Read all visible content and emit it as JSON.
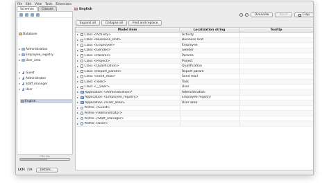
{
  "menu": [
    "File",
    "Edit",
    "View",
    "Tools",
    "Extensions"
  ],
  "tabs": [
    "Schemas",
    "Classes"
  ],
  "tree": {
    "items": [
      {
        "label": "Database",
        "icon": "database-icon"
      },
      {
        "label": "Administration",
        "icon": "folder-icon"
      },
      {
        "label": "Employee_registry",
        "icon": "folder-icon"
      },
      {
        "label": "User_area",
        "icon": "folder-icon"
      },
      {
        "label": "Guest",
        "icon": "user-icon"
      },
      {
        "label": "Administrator",
        "icon": "user-icon"
      },
      {
        "label": "Staff_manager",
        "icon": "user-icon"
      },
      {
        "label": "User",
        "icon": "user-icon"
      },
      {
        "label": "English",
        "icon": "flag-icon"
      }
    ]
  },
  "status": {
    "cpu_label": "CPU: 0%",
    "progress_label": "",
    "progress_fraction": 0.55,
    "lcf_label": "LCF:",
    "lcf_value": "739",
    "details_button": "Details..."
  },
  "editor": {
    "title": "English",
    "overview_button": "Overview",
    "reset_button": "Reset",
    "crop_button": "Crop",
    "expand_all": "Expand all",
    "collapse_all": "Collapse all",
    "find_replace": "Find and replace"
  },
  "table": {
    "columns": [
      "Model item",
      "Localization string",
      "Tooltip"
    ],
    "rows": [
      {
        "item": "Class <Activity>",
        "loc": "Activity",
        "type": "class"
      },
      {
        "item": "Class <Business_Unit>",
        "loc": "Business Unit",
        "type": "class"
      },
      {
        "item": "Class <Employee>",
        "loc": "Employee",
        "type": "class"
      },
      {
        "item": "Class <Gender>",
        "loc": "Gender",
        "type": "class"
      },
      {
        "item": "Class <Params>",
        "loc": "Params",
        "type": "class"
      },
      {
        "item": "Class <Project>",
        "loc": "Project",
        "type": "class"
      },
      {
        "item": "Class <Qualification>",
        "loc": "Qualification",
        "type": "class"
      },
      {
        "item": "Class <Report_param>",
        "loc": "Report param",
        "type": "class"
      },
      {
        "item": "Class <Send_mail>",
        "loc": "Send mail",
        "type": "class"
      },
      {
        "item": "Class <Task>",
        "loc": "Task",
        "type": "class"
      },
      {
        "item": "Class <__User>",
        "loc": "User",
        "type": "class"
      },
      {
        "item": "Application <Administration>",
        "loc": "Administration",
        "type": "app"
      },
      {
        "item": "Application <Employee_registry>",
        "loc": "Employee registry",
        "type": "app"
      },
      {
        "item": "Application <User_area>",
        "loc": "User area",
        "type": "app"
      },
      {
        "item": "Profile <Guest>",
        "loc": "",
        "type": "profile"
      },
      {
        "item": "Profile <Administrator>",
        "loc": "",
        "type": "profile"
      },
      {
        "item": "Profile <Staff_manager>",
        "loc": "",
        "type": "profile"
      },
      {
        "item": "Profile <User>",
        "loc": "",
        "type": "profile"
      }
    ]
  }
}
